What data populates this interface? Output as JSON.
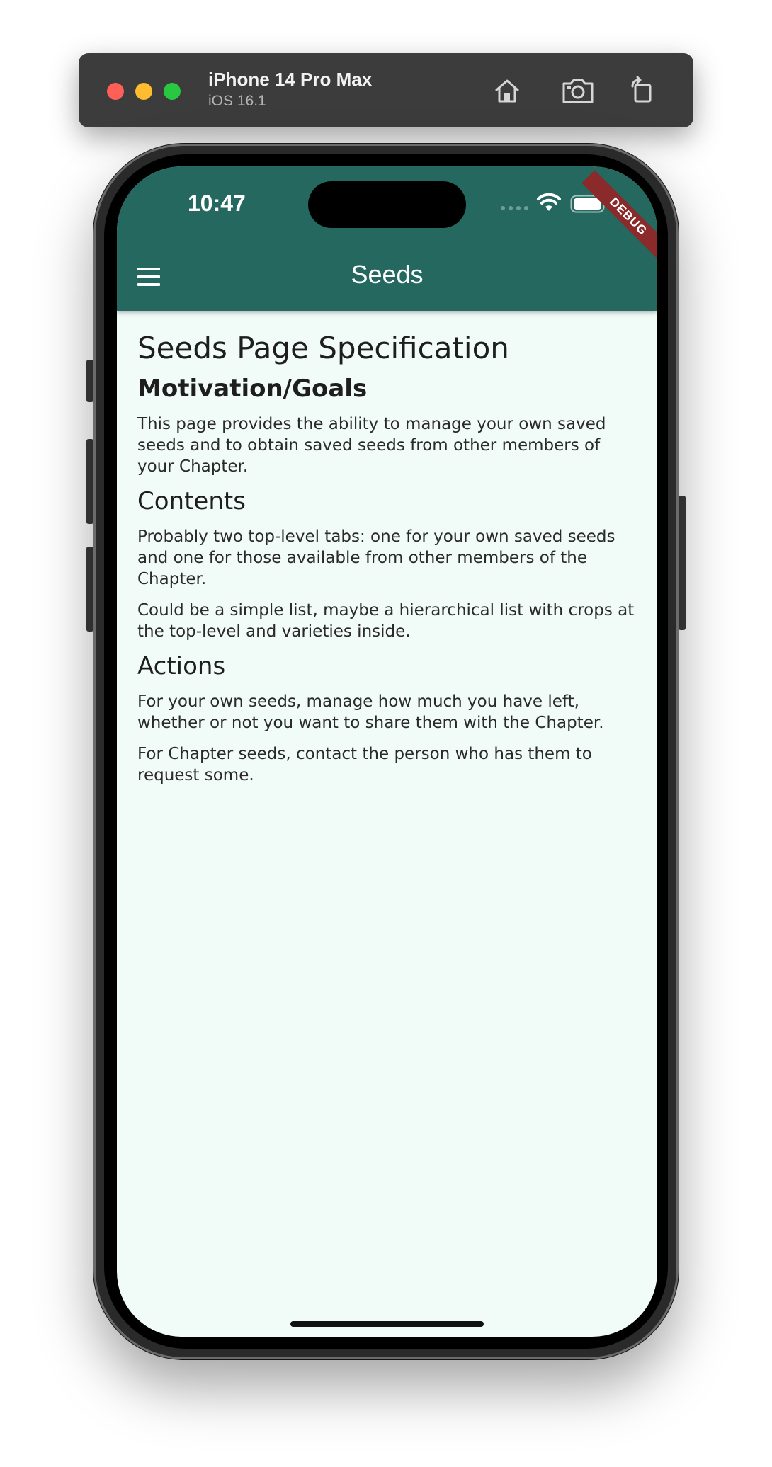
{
  "simulator": {
    "device_name": "iPhone 14 Pro Max",
    "os_version": "iOS 16.1",
    "buttons": [
      "home-icon",
      "screenshot-icon",
      "rotate-icon"
    ]
  },
  "status_bar": {
    "time": "10:47",
    "icons": [
      "cellular-icon",
      "wifi-icon",
      "battery-icon"
    ]
  },
  "debug_banner": "DEBUG",
  "app_bar": {
    "title": "Seeds",
    "menu_icon": "menu-icon",
    "background": "#246860"
  },
  "content": {
    "title": "Seeds Page Specification",
    "sections": [
      {
        "heading": "Motivation/Goals",
        "paragraphs": [
          "This page provides the ability to manage your own saved seeds and to obtain saved seeds from other members of your Chapter."
        ]
      },
      {
        "heading": "Contents",
        "paragraphs": [
          "Probably two top-level tabs: one for your own saved seeds and one for those available from other members of the Chapter.",
          "Could be a simple list, maybe a hierarchical list with crops at the top-level and varieties inside."
        ]
      },
      {
        "heading": "Actions",
        "paragraphs": [
          "For your own seeds, manage how much you have left, whether or not you want to share them with the Chapter.",
          "For Chapter seeds, contact the person who has them to request some."
        ]
      }
    ]
  }
}
